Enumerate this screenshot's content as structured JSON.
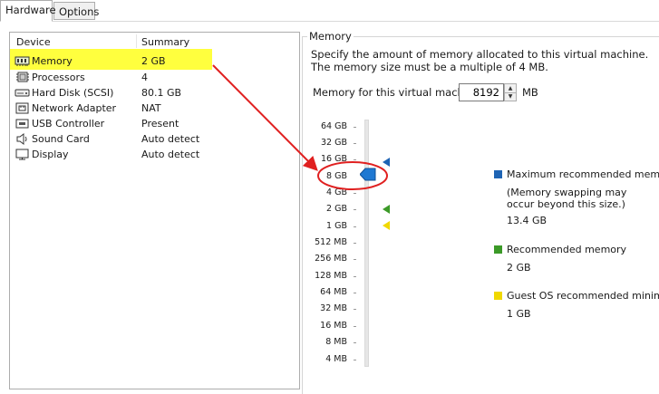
{
  "tabs": [
    {
      "label": "Hardware",
      "active": true
    },
    {
      "label": "Options",
      "active": false
    }
  ],
  "device_list": {
    "columns": {
      "device": "Device",
      "summary": "Summary"
    },
    "rows": [
      {
        "icon": "memory-icon",
        "device": "Memory",
        "summary": "2 GB",
        "selected": true
      },
      {
        "icon": "processor-icon",
        "device": "Processors",
        "summary": "4"
      },
      {
        "icon": "hard-disk-icon",
        "device": "Hard Disk (SCSI)",
        "summary": "80.1 GB"
      },
      {
        "icon": "network-adapter-icon",
        "device": "Network Adapter",
        "summary": "NAT"
      },
      {
        "icon": "usb-controller-icon",
        "device": "USB Controller",
        "summary": "Present"
      },
      {
        "icon": "sound-card-icon",
        "device": "Sound Card",
        "summary": "Auto detect"
      },
      {
        "icon": "display-icon",
        "device": "Display",
        "summary": "Auto detect"
      }
    ]
  },
  "memory": {
    "group_title": "Memory",
    "description": "Specify the amount of memory allocated to this virtual machine. The memory size must be a multiple of 4 MB.",
    "field_label": "Memory for this virtual machine:",
    "value": "8192",
    "unit": "MB",
    "slider_ticks": [
      "64 GB",
      "32 GB",
      "16 GB",
      "8 GB",
      "4 GB",
      "2 GB",
      "1 GB",
      "512 MB",
      "256 MB",
      "128 MB",
      "64 MB",
      "32 MB",
      "16 MB",
      "8 MB",
      "4 MB"
    ],
    "current_tick": "8 GB",
    "legend": {
      "max": {
        "label": "Maximum recommended memory",
        "note1": "(Memory swapping may",
        "note2": "occur beyond this size.)",
        "value": "13.4 GB",
        "color": "#1e64b4"
      },
      "recommended": {
        "label": "Recommended memory",
        "value": "2 GB",
        "color": "#3c9a28"
      },
      "guest_min": {
        "label": "Guest OS recommended minimum",
        "value": "1 GB",
        "color": "#f0d800"
      }
    }
  },
  "colors": {
    "annotation": "#e02020",
    "highlight": "#ffff3e",
    "slider_thumb": "#1e78d2"
  }
}
